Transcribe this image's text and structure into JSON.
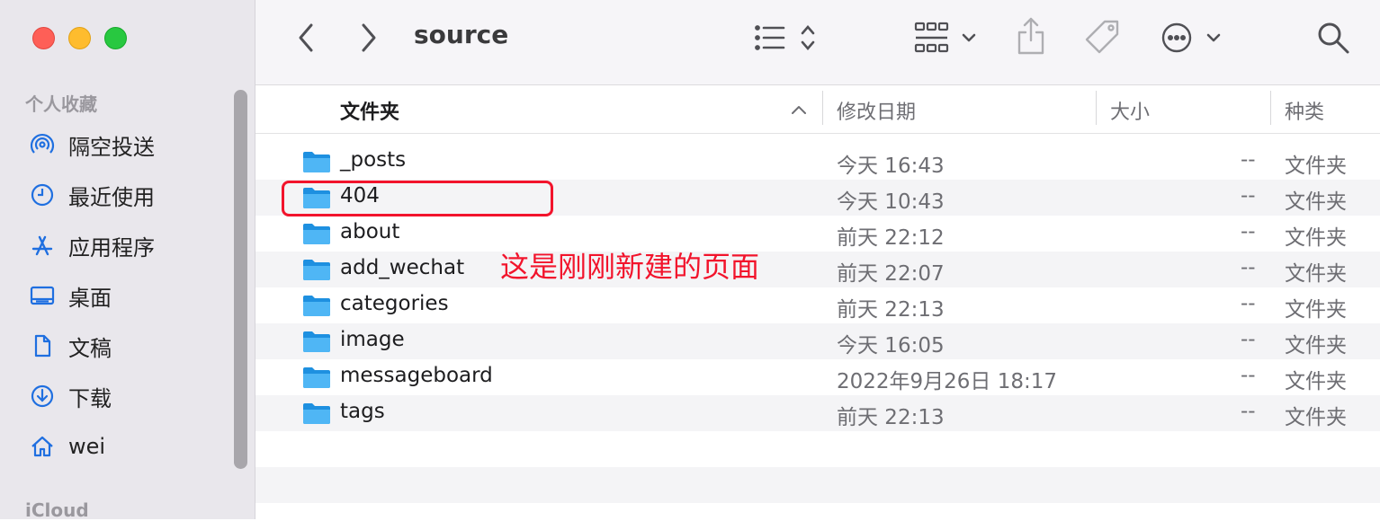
{
  "window": {
    "title": "source"
  },
  "sidebar": {
    "favorites_heading": "个人收藏",
    "items": [
      {
        "label": "隔空投送",
        "icon": "airdrop-icon"
      },
      {
        "label": "最近使用",
        "icon": "clock-icon"
      },
      {
        "label": "应用程序",
        "icon": "applications-icon"
      },
      {
        "label": "桌面",
        "icon": "desktop-icon"
      },
      {
        "label": "文稿",
        "icon": "document-icon"
      },
      {
        "label": "下载",
        "icon": "download-icon"
      },
      {
        "label": "wei",
        "icon": "home-icon"
      }
    ],
    "icloud_heading": "iCloud"
  },
  "toolbar": {
    "back": "chevron-left-icon",
    "forward": "chevron-right-icon",
    "view": "list-view-icon",
    "group": "grid-group-icon",
    "share": "share-icon",
    "tag": "tag-icon",
    "more": "ellipsis-circle-icon",
    "search": "search-icon"
  },
  "columns": {
    "name": "文件夹",
    "date": "修改日期",
    "size": "大小",
    "kind": "种类"
  },
  "files": [
    {
      "name": "_posts",
      "date": "今天 16:43",
      "size": "--",
      "kind": "文件夹"
    },
    {
      "name": "404",
      "date": "今天 10:43",
      "size": "--",
      "kind": "文件夹"
    },
    {
      "name": "about",
      "date": "前天 22:12",
      "size": "--",
      "kind": "文件夹"
    },
    {
      "name": "add_wechat",
      "date": "前天 22:07",
      "size": "--",
      "kind": "文件夹"
    },
    {
      "name": "categories",
      "date": "前天 22:13",
      "size": "--",
      "kind": "文件夹"
    },
    {
      "name": "image",
      "date": "今天 16:05",
      "size": "--",
      "kind": "文件夹"
    },
    {
      "name": "messageboard",
      "date": "2022年9月26日 18:17",
      "size": "--",
      "kind": "文件夹"
    },
    {
      "name": "tags",
      "date": "前天 22:13",
      "size": "--",
      "kind": "文件夹"
    }
  ],
  "annotation": {
    "text": "这是刚刚新建的页面",
    "color": "#f2142c"
  },
  "colors": {
    "folder": "#3ba9f0",
    "accent": "#007aff",
    "sidebar_bg": "#e9e7ec"
  }
}
